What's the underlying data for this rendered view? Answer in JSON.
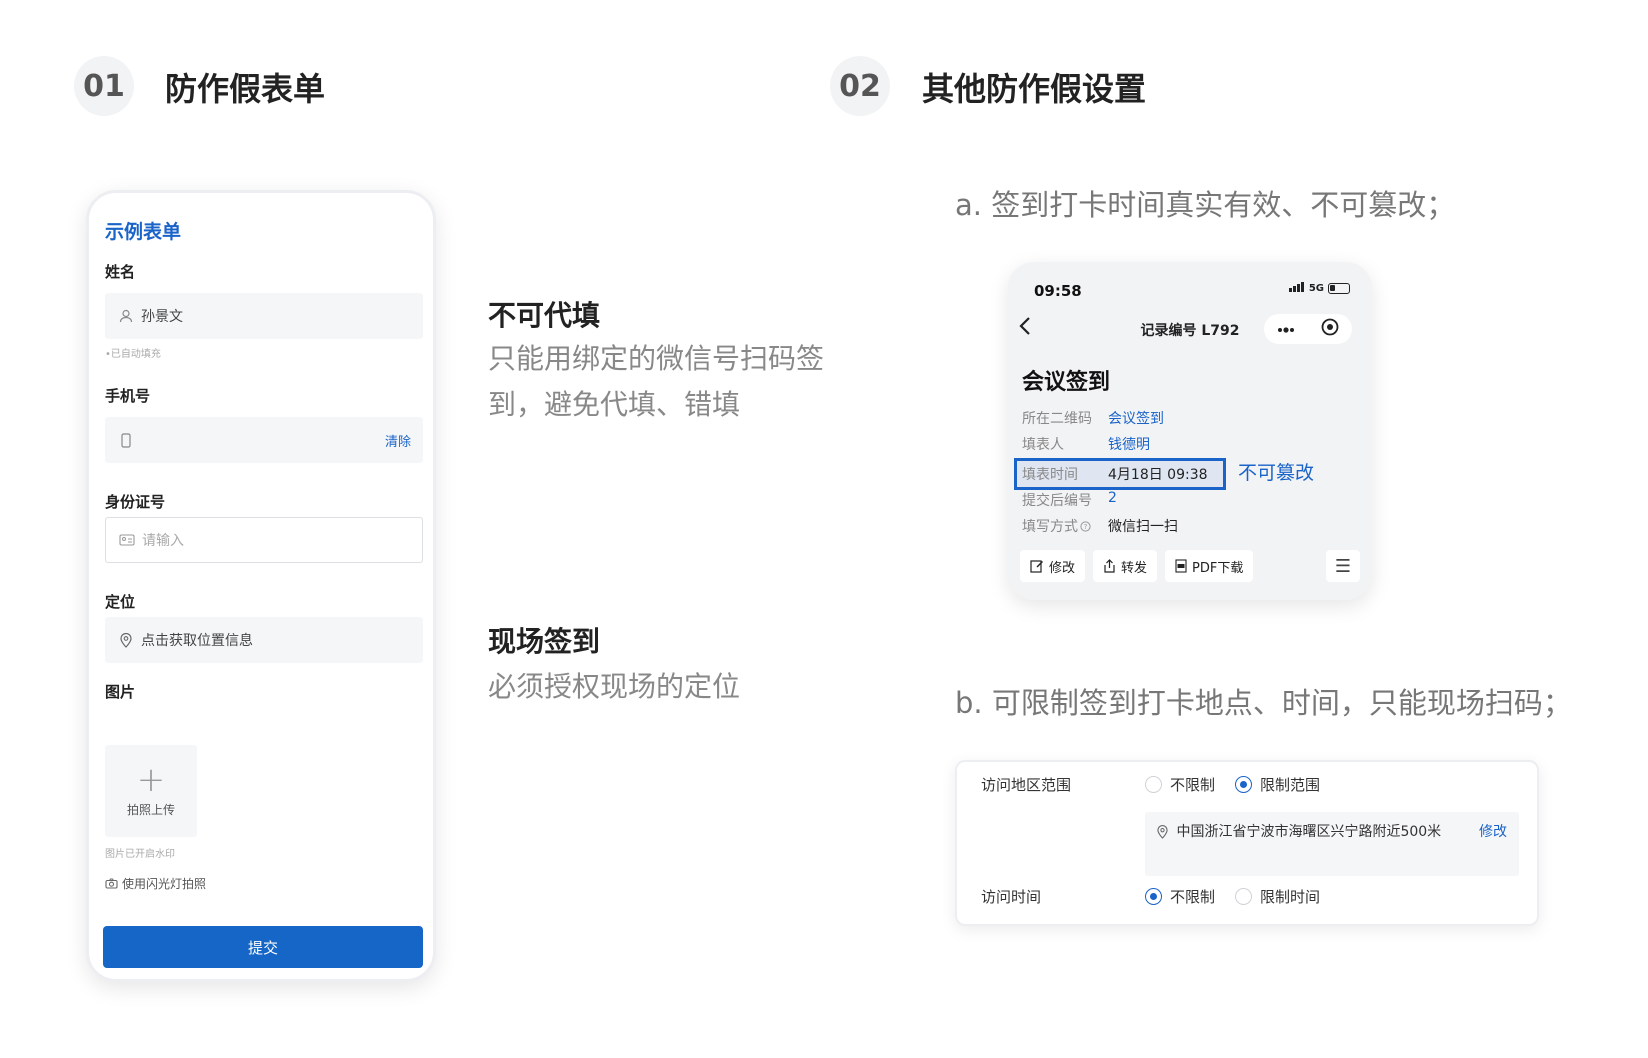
{
  "section1": {
    "num": "01",
    "title": "防作假表单"
  },
  "section2": {
    "num": "02",
    "title": "其他防作假设置"
  },
  "form": {
    "title": "示例表单",
    "name_label": "姓名",
    "name_value": "孙景文",
    "name_hint": "•已自动填充",
    "phone_label": "手机号",
    "phone_clear": "清除",
    "id_label": "身份证号",
    "id_placeholder": "请输入",
    "location_label": "定位",
    "location_value": "点击获取位置信息",
    "image_label": "图片",
    "upload_plus": "+",
    "upload_text": "拍照上传",
    "watermark_hint": "图片已开启水印",
    "flash_text": "使用闪光灯拍照",
    "submit": "提交"
  },
  "features": [
    {
      "title": "不可代填",
      "desc_line1": "只能用绑定的微信号扫码签",
      "desc_line2": "到，避免代填、错填"
    },
    {
      "title": "现场签到",
      "desc_line1": "必须授权现场的定位"
    }
  ],
  "note_a": "a. 签到打卡时间真实有效、不可篡改；",
  "note_b": "b. 可限制签到打卡地点、时间，只能现场扫码；",
  "record": {
    "time": "09:58",
    "network": "5G",
    "nav_title": "记录编号 L792",
    "heading": "会议签到",
    "rows": [
      {
        "k": "所在二维码",
        "v": "会议签到"
      },
      {
        "k": "填表人",
        "v": "钱德明"
      },
      {
        "k": "填表时间",
        "v": "4月18日 09:38"
      },
      {
        "k": "提交后编号",
        "v": "2"
      },
      {
        "k": "填写方式",
        "v": "微信扫一扫"
      }
    ],
    "highlight_note": "不可篡改",
    "buttons": {
      "edit": "修改",
      "forward": "转发",
      "pdf": "PDF下载"
    }
  },
  "settings": {
    "region_label": "访问地区范围",
    "region_opt1": "不限制",
    "region_opt2": "限制范围",
    "address": "中国浙江省宁波市海曙区兴宁路附近500米",
    "address_edit": "修改",
    "time_label": "访问时间",
    "time_opt1": "不限制",
    "time_opt2": "限制时间"
  }
}
